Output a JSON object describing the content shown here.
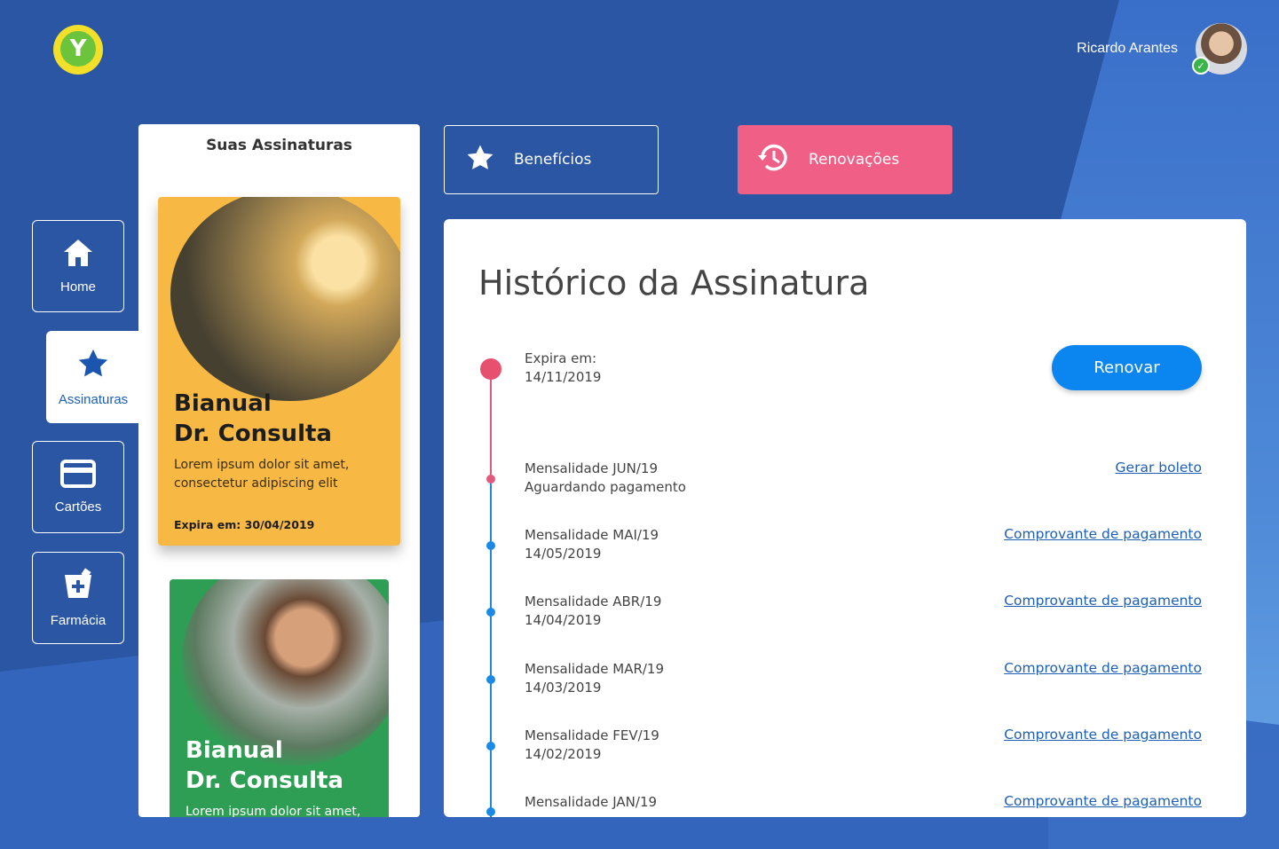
{
  "header": {
    "logo_letter": "Y",
    "user_name": "Ricardo Arantes"
  },
  "nav": [
    {
      "label": "Home",
      "icon": "home-icon"
    },
    {
      "label": "Assinaturas",
      "icon": "star-icon",
      "active": true
    },
    {
      "label": "Cartões",
      "icon": "card-icon"
    },
    {
      "label": "Farmácia",
      "icon": "pharmacy-icon"
    }
  ],
  "subscriptions": {
    "title": "Suas Assinaturas",
    "cards": [
      {
        "title_line1": "Bianual",
        "title_line2": "Dr. Consulta",
        "desc": "Lorem ipsum dolor sit amet, consectetur adipiscing elit",
        "expires": "Expira em: 30/04/2019",
        "color": "#f7b943"
      },
      {
        "title_line1": "Bianual",
        "title_line2": "Dr. Consulta",
        "desc": "Lorem ipsum dolor sit amet,",
        "color": "#2f9e55"
      }
    ]
  },
  "tabs": {
    "benefits": "Benefícios",
    "renewals": "Renovações"
  },
  "history": {
    "title": "Histórico da Assinatura",
    "renew_button": "Renovar",
    "current": {
      "line1": "Expira em:",
      "line2": "14/11/2019"
    },
    "entries": [
      {
        "line1": "Mensalidade JUN/19",
        "line2": "Aguardando pagamento",
        "link": "Gerar boleto"
      },
      {
        "line1": "Mensalidade MAI/19",
        "line2": "14/05/2019",
        "link": "Comprovante de pagamento"
      },
      {
        "line1": "Mensalidade ABR/19",
        "line2": "14/04/2019",
        "link": "Comprovante de pagamento"
      },
      {
        "line1": "Mensalidade MAR/19",
        "line2": "14/03/2019",
        "link": "Comprovante de pagamento"
      },
      {
        "line1": "Mensalidade FEV/19",
        "line2": "14/02/2019",
        "link": "Comprovante de pagamento"
      },
      {
        "line1": "Mensalidade JAN/19",
        "line2": "",
        "link": "Comprovante de pagamento"
      }
    ]
  },
  "colors": {
    "background": "#2b56a3",
    "accent_pink": "#ef5f86",
    "accent_blue": "#0b85f0",
    "link": "#1f5fb3"
  }
}
